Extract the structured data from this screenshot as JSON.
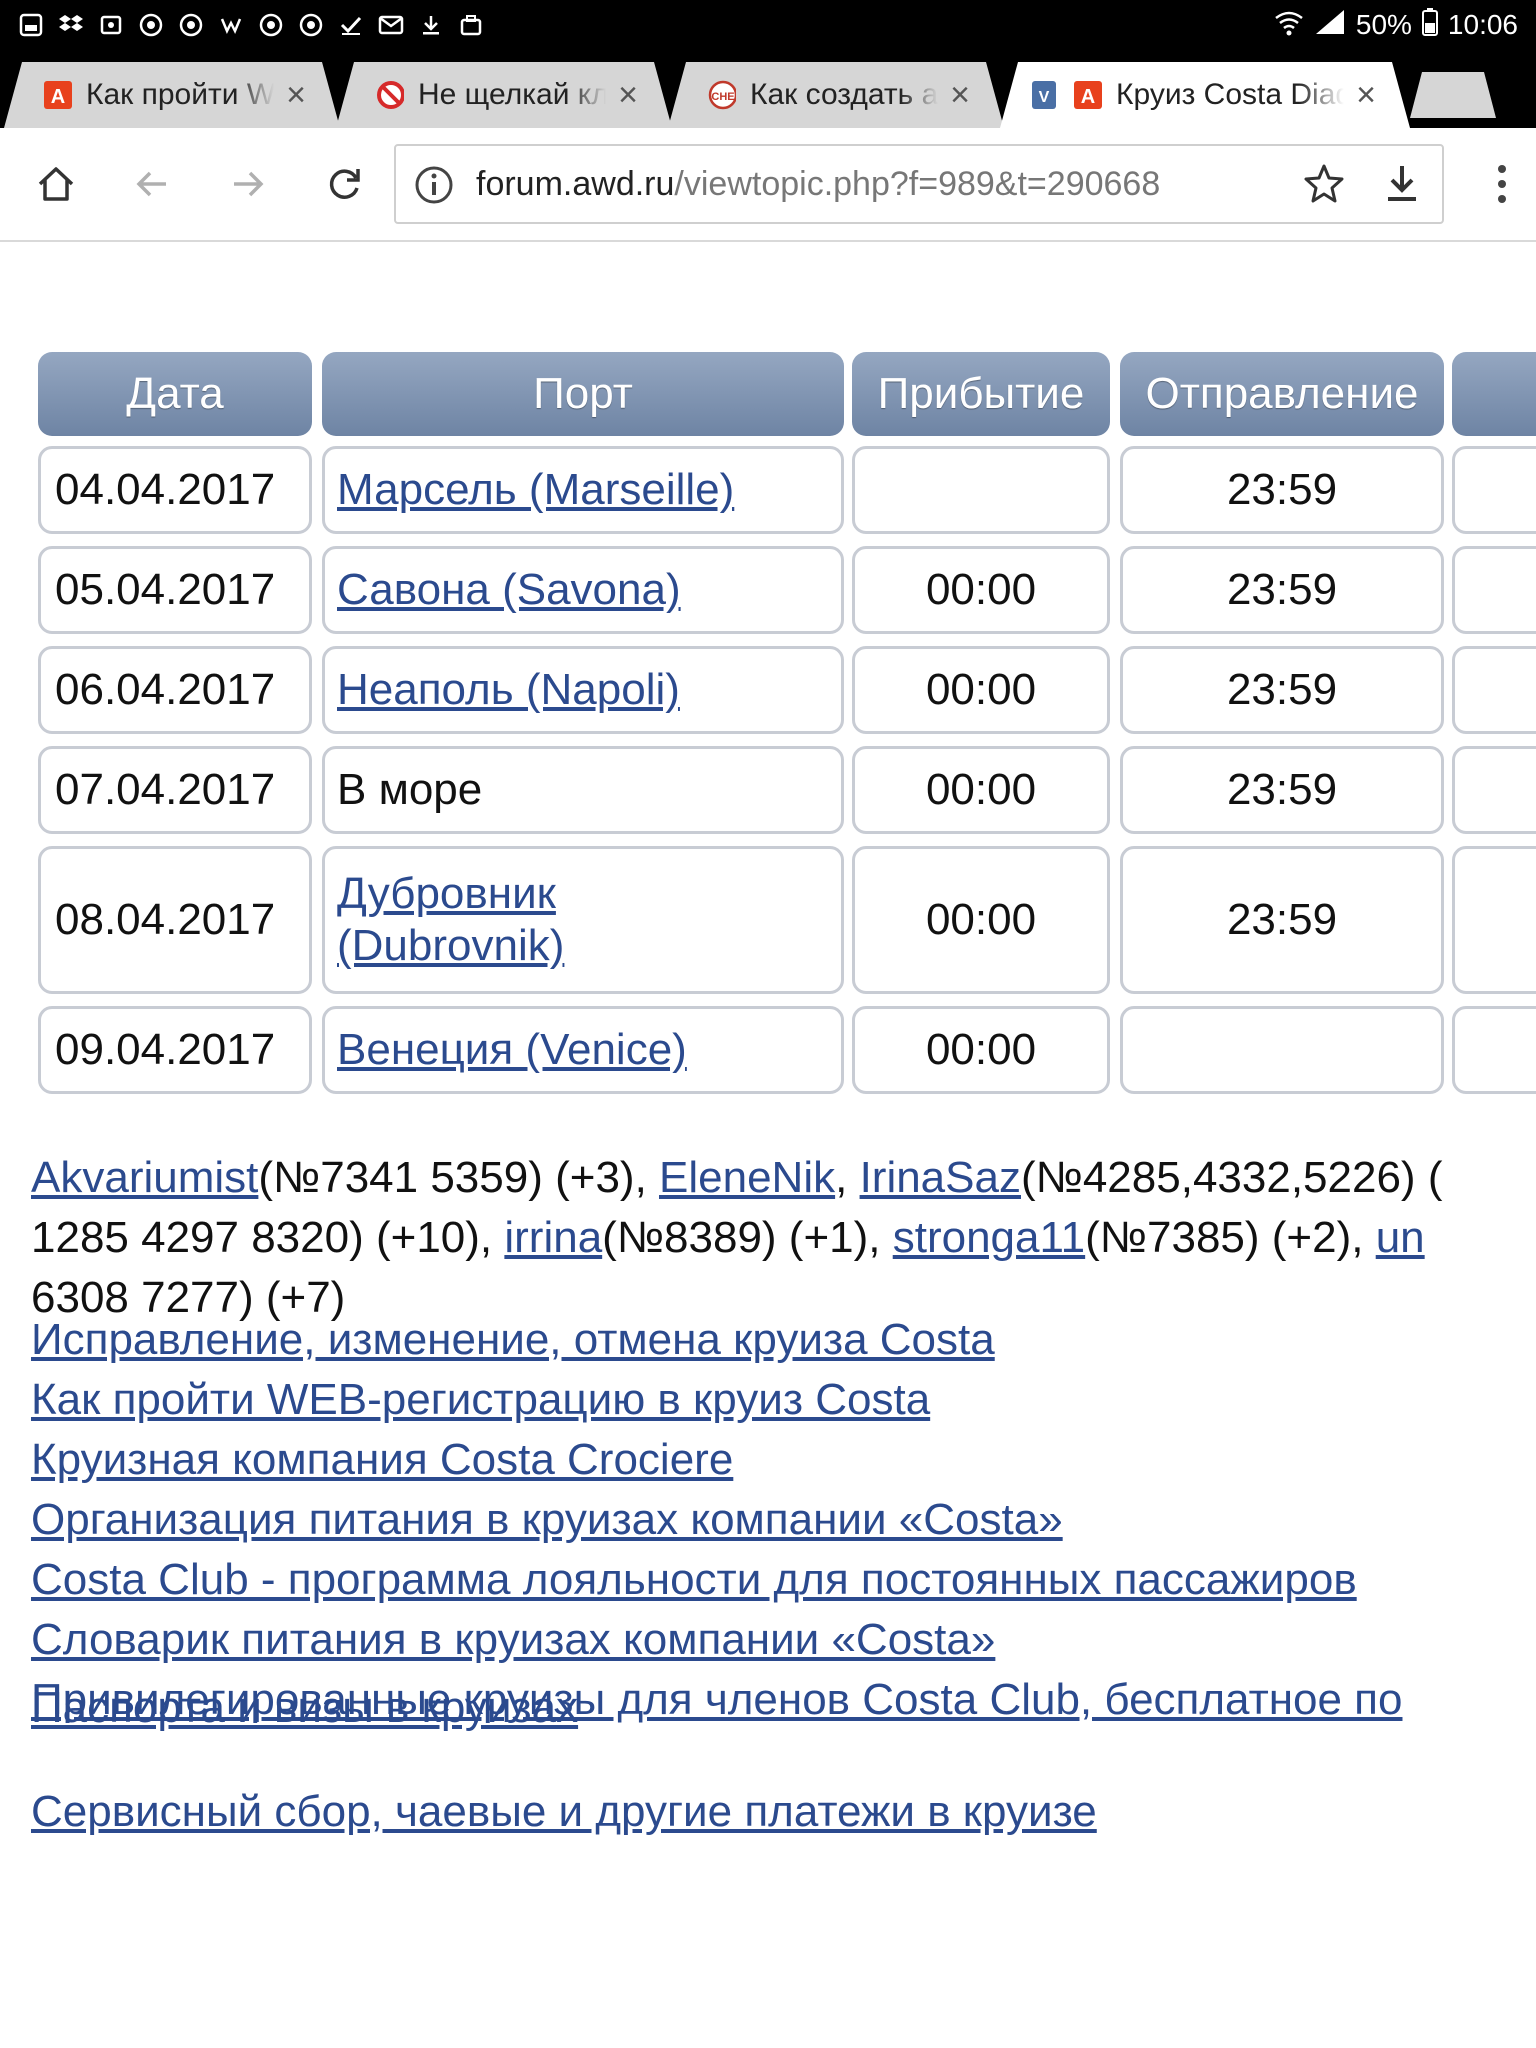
{
  "status_bar": {
    "battery": "50%",
    "time": "10:06",
    "icons": [
      "screenshot-icon",
      "dropbox-icon",
      "gallery-icon",
      "chrome-icon",
      "chrome-icon",
      "vk-icon",
      "chrome-icon",
      "chrome-icon",
      "check-icon",
      "mail-icon",
      "download-icon",
      "briefcase-icon"
    ]
  },
  "tabs": [
    {
      "title": "Как пройти WEB-регистрацию",
      "favicon": "awd-icon",
      "favicon_color": "#e8411d",
      "active": false
    },
    {
      "title": "Не щелкай клювом",
      "favicon": "no-beak-icon",
      "favicon_color": "#d62a2a",
      "active": false
    },
    {
      "title": "Как создать аккаунт",
      "favicon": "che-icon",
      "favicon_color": "#c0392b",
      "active": false
    },
    {
      "title": "Круиз Costa Diadema",
      "favicon": "awd-icon",
      "favicon_color": "#e8411d",
      "active": true
    }
  ],
  "toolbar": {
    "url_host": "forum.awd.ru",
    "url_path": "/viewtopic.php?f=989&t=290668"
  },
  "table": {
    "headers": [
      "Дата",
      "Порт",
      "Прибытие",
      "Отправление",
      ""
    ],
    "rows": [
      {
        "date": "04.04.2017",
        "port": "Марсель (Marseille)",
        "port_link": true,
        "arrival": "",
        "departure": "23:59"
      },
      {
        "date": "05.04.2017",
        "port": "Савона (Savona)",
        "port_link": true,
        "arrival": "00:00",
        "departure": "23:59"
      },
      {
        "date": "06.04.2017",
        "port": "Неаполь (Napoli)",
        "port_link": true,
        "arrival": "00:00",
        "departure": "23:59"
      },
      {
        "date": "07.04.2017",
        "port": "В море",
        "port_link": false,
        "arrival": "00:00",
        "departure": "23:59"
      },
      {
        "date": "08.04.2017",
        "port": "Дубровник (Dubrovnik)",
        "port_link": true,
        "port_line1": "Дубровник",
        "port_line2": "(Dubrovnik)",
        "arrival": "00:00",
        "departure": "23:59"
      },
      {
        "date": "09.04.2017",
        "port": "Венеция (Venice)",
        "port_link": true,
        "arrival": "00:00",
        "departure": ""
      }
    ]
  },
  "members": {
    "u1": "Akvariumist",
    "u1_note": "(№7341 5359) (+3), ",
    "u2": "EleneNik",
    "sep": ", ",
    "u3": "IrinaSaz",
    "u3_note": "(№4285,4332,5226) (",
    "line2_start": "1285 4297 8320) (+10), ",
    "u4": "irrina",
    "u4_note": "(№8389) (+1), ",
    "u5": "stronga11",
    "u5_note": "(№7385) (+2), ",
    "u6": "un",
    "line3": "6308 7277) (+7)"
  },
  "links": [
    "Исправление, изменение, отмена круиза Costa",
    "Как пройти WEB-регистрацию в круиз Costa",
    "Круизная компания Costa Crociere",
    "Организация питания в круизах компании «Costa»",
    "Costa Club - программа лояльности для постоянных пассажиров",
    "Словарик питания в круизах компании «Costa»",
    "Привилегированные круизы для членов Costa Club, бесплатное по"
  ],
  "link_passports": "Паспорта и визы в круизах",
  "link_fees": "Сервисный сбор, чаевые и другие платежи в круизе",
  "colors": {
    "link": "#2b4a8e",
    "header_top": "#95a7c1",
    "header_bottom": "#6e84a4",
    "cell_border": "#c8ccd4"
  }
}
